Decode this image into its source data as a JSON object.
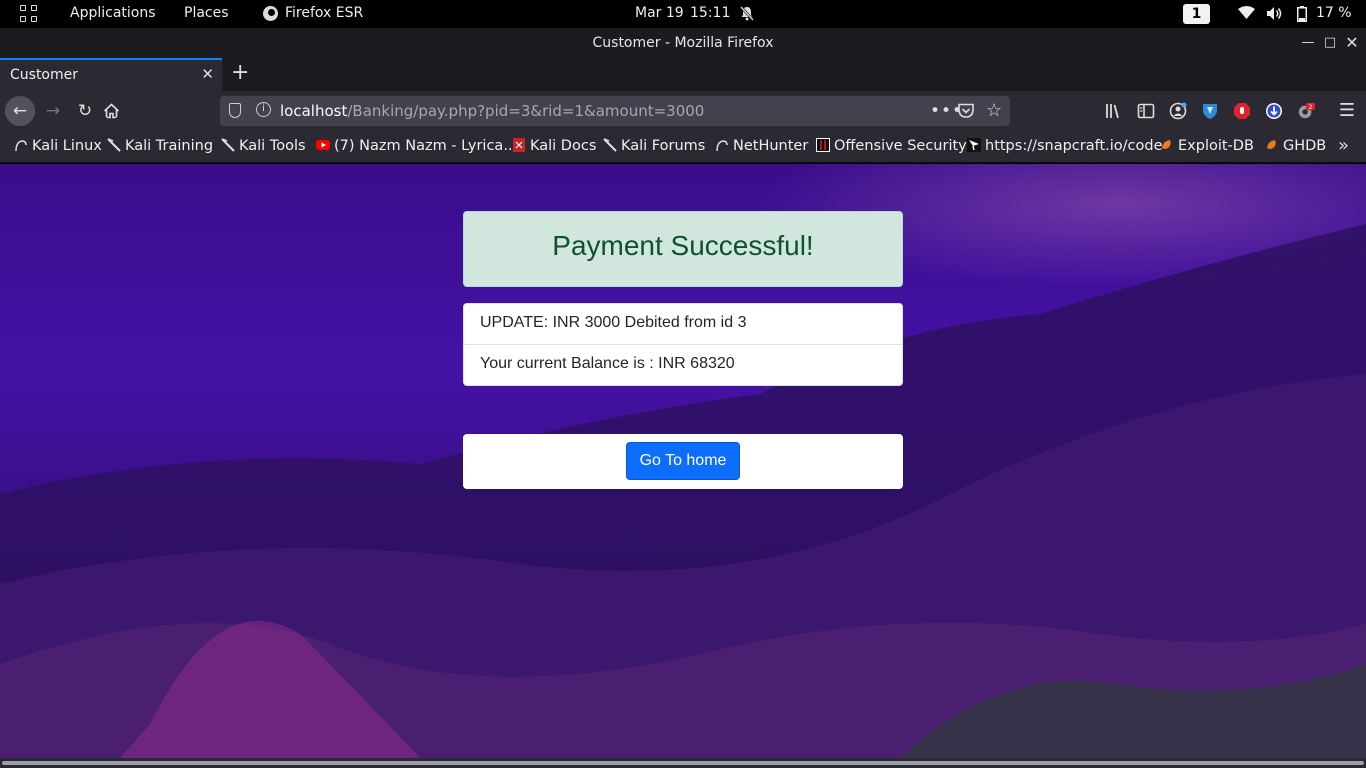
{
  "topbar": {
    "applications": "Applications",
    "places": "Places",
    "active_app": "Firefox ESR",
    "date": "Mar 19",
    "time": "15:11",
    "workspace": "1",
    "battery": "17 %"
  },
  "window": {
    "title": "Customer - Mozilla Firefox"
  },
  "tabs": [
    {
      "title": "Customer"
    }
  ],
  "urlbar": {
    "host": "localhost",
    "path": "/Banking/pay.php?pid=3&rid=1&amount=3000"
  },
  "bookmarks": [
    {
      "label": "Kali Linux",
      "icon": "kali-dragon-icon"
    },
    {
      "label": "Kali Training",
      "icon": "kali-knife-icon"
    },
    {
      "label": "Kali Tools",
      "icon": "kali-knife-icon"
    },
    {
      "label": "(7) Nazm Nazm - Lyrica...",
      "icon": "youtube-icon"
    },
    {
      "label": "Kali Docs",
      "icon": "kali-docs-icon"
    },
    {
      "label": "Kali Forums",
      "icon": "kali-knife-icon"
    },
    {
      "label": "NetHunter",
      "icon": "kali-dragon-icon"
    },
    {
      "label": "Offensive Security",
      "icon": "offsec-icon"
    },
    {
      "label": "https://snapcraft.io/code",
      "icon": "snapcraft-icon"
    },
    {
      "label": "Exploit-DB",
      "icon": "exploitdb-icon"
    },
    {
      "label": "GHDB",
      "icon": "exploitdb-icon"
    }
  ],
  "page": {
    "success_message": "Payment Successful!",
    "update_line": "UPDATE: INR 3000 Debited from id 3",
    "balance_line": "Your current Balance is : INR 68320",
    "home_button": "Go To home"
  },
  "colors": {
    "success_bg": "#d1e7dd",
    "success_text": "#0f5132",
    "primary_button": "#0d6efd",
    "browser_chrome": "#2b2a33"
  }
}
